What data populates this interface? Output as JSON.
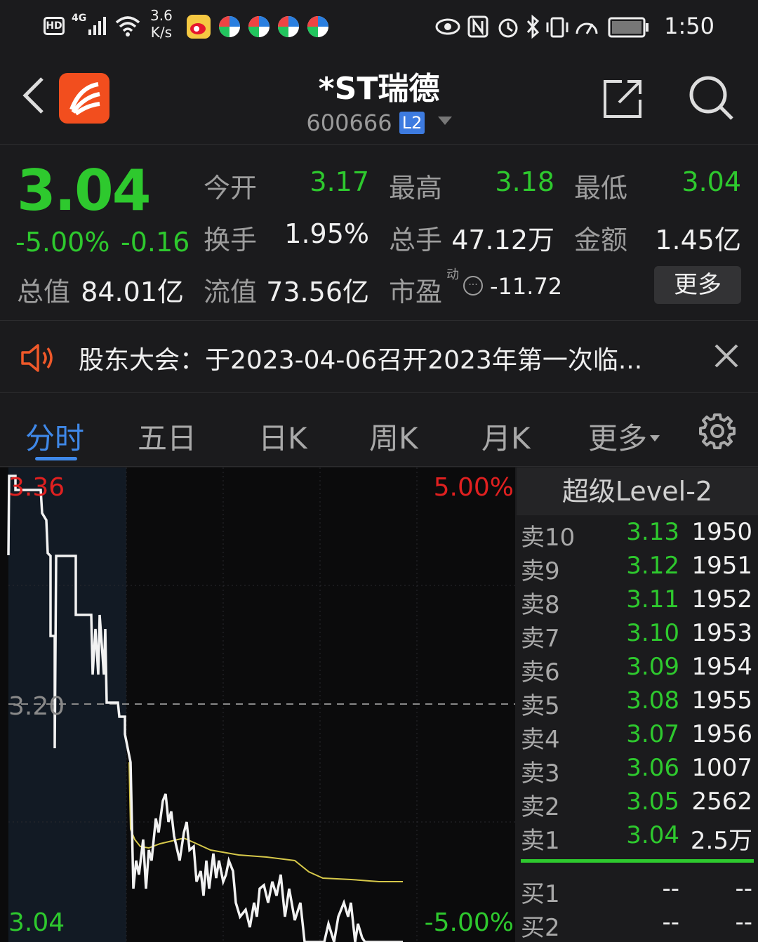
{
  "status_bar": {
    "hd": "HD",
    "net": "4G",
    "speed_value": "3.6",
    "speed_unit": "K/s",
    "time": "1:50"
  },
  "header": {
    "name": "*ST瑞德",
    "code": "600666",
    "level_badge": "L2"
  },
  "quote": {
    "price": "3.04",
    "change_pct": "-5.00%",
    "change": "-0.16",
    "open_label": "今开",
    "open": "3.17",
    "high_label": "最高",
    "high": "3.18",
    "low_label": "最低",
    "low": "3.04",
    "turnover_label": "换手",
    "turnover": "1.95%",
    "volume_label": "总手",
    "volume": "47.12万",
    "amount_label": "金额",
    "amount": "1.45亿",
    "total_cap_label": "总值",
    "total_cap": "84.01亿",
    "float_cap_label": "流值",
    "float_cap": "73.56亿",
    "pe_label": "市盈",
    "pe_sup": "动",
    "pe": "-11.72",
    "more": "更多"
  },
  "notice": {
    "text": "股东大会：于2023-04-06召开2023年第一次临..."
  },
  "tabs": [
    {
      "label": "分时"
    },
    {
      "label": "五日"
    },
    {
      "label": "日K"
    },
    {
      "label": "周K"
    },
    {
      "label": "月K"
    },
    {
      "label": "更多"
    }
  ],
  "chart_labels": {
    "top_price": "3.36",
    "mid_price": "3.20",
    "bottom_price": "3.04",
    "top_pct": "5.00%",
    "bottom_pct": "-5.00%"
  },
  "chart_data": {
    "type": "line",
    "y_range": [
      3.04,
      3.36
    ],
    "prev_close": 3.2,
    "series": []
  },
  "order_book": {
    "title": "超级Level-2",
    "asks": [
      {
        "label": "卖10",
        "price": "3.13",
        "volume": "1950"
      },
      {
        "label": "卖9",
        "price": "3.12",
        "volume": "1951"
      },
      {
        "label": "卖8",
        "price": "3.11",
        "volume": "1952"
      },
      {
        "label": "卖7",
        "price": "3.10",
        "volume": "1953"
      },
      {
        "label": "卖6",
        "price": "3.09",
        "volume": "1954"
      },
      {
        "label": "卖5",
        "price": "3.08",
        "volume": "1955"
      },
      {
        "label": "卖4",
        "price": "3.07",
        "volume": "1956"
      },
      {
        "label": "卖3",
        "price": "3.06",
        "volume": "1007"
      },
      {
        "label": "卖2",
        "price": "3.05",
        "volume": "2562"
      },
      {
        "label": "卖1",
        "price": "3.04",
        "volume": "2.5万"
      }
    ],
    "bids": [
      {
        "label": "买1",
        "price": "--",
        "volume": "--"
      },
      {
        "label": "买2",
        "price": "--",
        "volume": "--"
      }
    ]
  },
  "colors": {
    "down": "#2ec92e",
    "up": "#e02020",
    "accent": "#3f88e8",
    "avg_line": "#d6c84a"
  }
}
